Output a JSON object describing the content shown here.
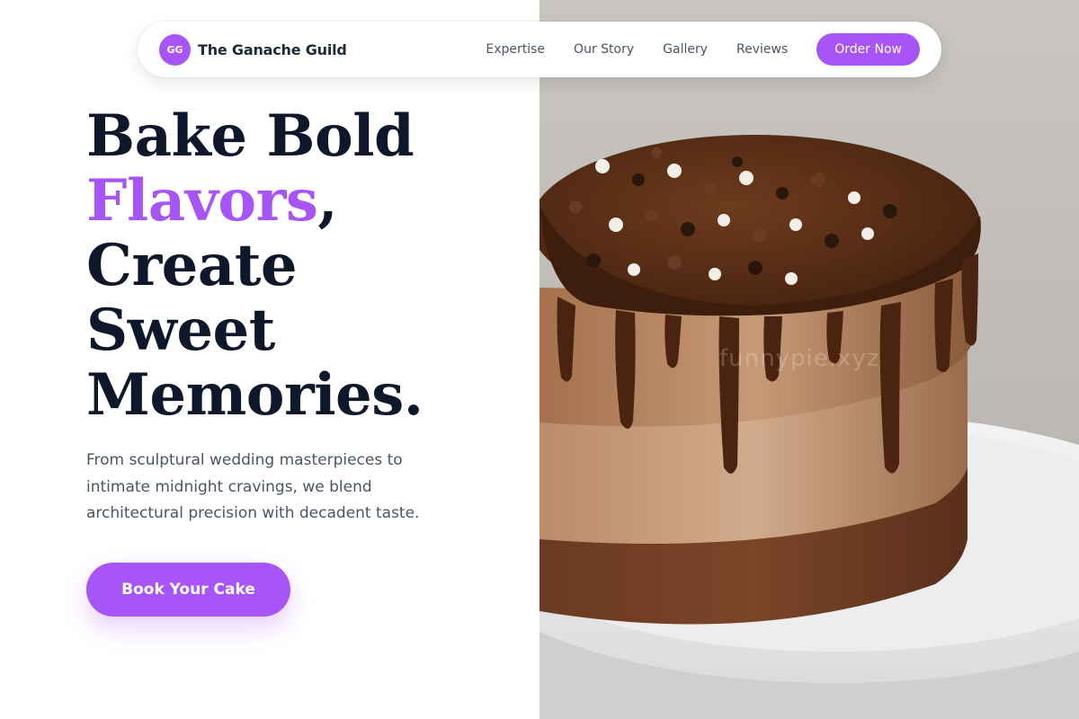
{
  "brand": {
    "initials": "GG",
    "name": "The Ganache Guild"
  },
  "nav": {
    "links": [
      "Expertise",
      "Our Story",
      "Gallery",
      "Reviews"
    ],
    "cta_label": "Order Now"
  },
  "hero": {
    "headline": {
      "line1": "Bake Bold",
      "accent_word": "Flavors",
      "accent_suffix": ",",
      "line3": "Create",
      "line4": "Sweet",
      "line5": "Memories."
    },
    "subtext": "From sculptural wedding masterpieces to intimate midnight cravings, we blend architectural precision with decadent taste.",
    "cta_label": "Book Your Cake",
    "image_alt": "Chocolate mousse cake with chocolate drip and pearl sprinkles",
    "watermark": "funnypie.xyz"
  },
  "colors": {
    "accent": "#a855f7",
    "headline": "#0f172a",
    "body_text": "#4b5563",
    "background": "#ffffff"
  }
}
